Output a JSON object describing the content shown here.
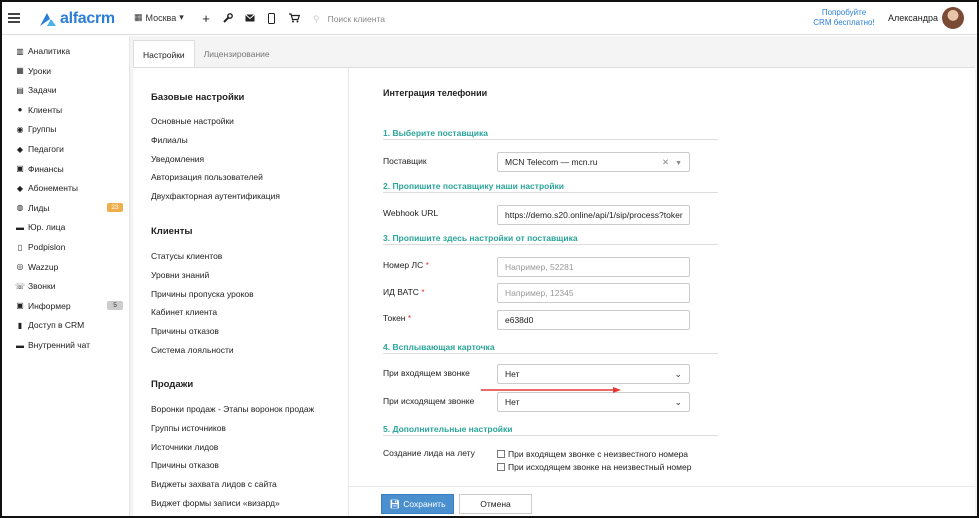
{
  "header": {
    "logo_text": "alfacrm",
    "city": "Москва",
    "search_placeholder": "Поиск клиента",
    "promo_line1": "Попробуйте",
    "promo_line2": "CRM бесплатно!",
    "user_name": "Александра"
  },
  "sidebar": {
    "items": [
      {
        "label": "Аналитика",
        "icon": "chart-icon"
      },
      {
        "label": "Уроки",
        "icon": "calendar-icon"
      },
      {
        "label": "Задачи",
        "icon": "clipboard-icon"
      },
      {
        "label": "Клиенты",
        "icon": "user-icon"
      },
      {
        "label": "Группы",
        "icon": "users-icon"
      },
      {
        "label": "Педагоги",
        "icon": "graduation-cap-icon"
      },
      {
        "label": "Финансы",
        "icon": "money-icon"
      },
      {
        "label": "Абонементы",
        "icon": "tag-icon"
      },
      {
        "label": "Лиды",
        "icon": "user-plus-icon",
        "badge": "23"
      },
      {
        "label": "Юр. лица",
        "icon": "briefcase-icon"
      },
      {
        "label": "Podpislon",
        "icon": "document-icon"
      },
      {
        "label": "Wazzup",
        "icon": "whatsapp-icon"
      },
      {
        "label": "Звонки",
        "icon": "phone-icon"
      },
      {
        "label": "Информер",
        "icon": "inbox-icon",
        "badge": "5"
      },
      {
        "label": "Доступ в CRM",
        "icon": "lock-icon"
      },
      {
        "label": "Внутренний чат",
        "icon": "chat-icon"
      }
    ]
  },
  "tabs": [
    {
      "label": "Настройки",
      "active": true
    },
    {
      "label": "Лицензирование",
      "active": false
    }
  ],
  "settings_nav": {
    "base_head": "Базовые настройки",
    "base_links": [
      "Основные настройки",
      "Филиалы",
      "Уведомления",
      "Авторизация пользователей",
      "Двухфакторная аутентификация"
    ],
    "clients_head": "Клиенты",
    "clients_links": [
      "Статусы клиентов",
      "Уровни знаний",
      "Причины пропуска уроков",
      "Кабинет клиента",
      "Причины отказов",
      "Система лояльности"
    ],
    "sales_head": "Продажи",
    "sales_links": [
      "Воронки продаж - Этапы воронок продаж",
      "Группы источников",
      "Источники лидов",
      "Причины отказов",
      "Виджеты захвата лидов с сайта",
      "Виджет формы записи «визард»"
    ]
  },
  "form": {
    "title": "Интеграция телефонии",
    "s1": "1. Выберите поставщика",
    "provider_label": "Поставщик",
    "provider_value": "MCN Telecom — mcn.ru",
    "s2": "2. Пропишите поставщику наши настройки",
    "webhook_label": "Webhook URL",
    "webhook_value": "https://demo.s20.online/api/1/sip/process?toker",
    "s3": "3. Пропишите здесь настройки от поставщика",
    "ls_label": "Номер ЛС",
    "ls_placeholder": "Например, 52281",
    "vats_label": "ИД ВАТС",
    "vats_placeholder": "Например, 12345",
    "token_label": "Токен",
    "token_value": "e638d0",
    "s4": "4. Всплывающая карточка",
    "incoming_label": "При входящем звонке",
    "incoming_value": "Нет",
    "outgoing_label": "При исходящем звонке",
    "outgoing_value": "Нет",
    "s5": "5. Дополнительные настройки",
    "lead_label": "Создание лида на лету",
    "check1": "При входящем звонке с неизвестного номера",
    "check2": "При исходящем звонке на неизвестный номер",
    "save_label": "Сохранить",
    "cancel_label": "Отмена"
  },
  "colors": {
    "accent": "#2b7fd6",
    "section": "#2aa59a",
    "save": "#4a8fce",
    "arrow": "#e53935",
    "badge_orange": "#f0ad4e"
  }
}
